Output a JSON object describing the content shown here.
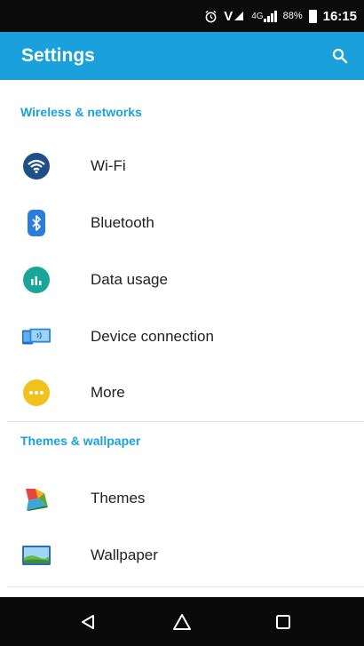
{
  "status_bar": {
    "alarm_icon": "alarm-clock-icon",
    "volte_label": "V",
    "network_type": "4G",
    "battery_percent": "88%",
    "time": "16:15"
  },
  "app_bar": {
    "title": "Settings",
    "search_icon": "search-icon"
  },
  "sections": [
    {
      "header": "Wireless & networks",
      "items": [
        {
          "label": "Wi-Fi",
          "icon": "wifi-icon",
          "color": "#1e4f87"
        },
        {
          "label": "Bluetooth",
          "icon": "bluetooth-icon",
          "color": "#2a7dd9"
        },
        {
          "label": "Data usage",
          "icon": "data-usage-icon",
          "color": "#1aa59a"
        },
        {
          "label": "Device connection",
          "icon": "device-connection-icon",
          "color": "#2f8ad6"
        },
        {
          "label": "More",
          "icon": "more-icon",
          "color": "#f1c21b"
        }
      ]
    },
    {
      "header": "Themes & wallpaper",
      "items": [
        {
          "label": "Themes",
          "icon": "themes-icon",
          "color": "#e8463a"
        },
        {
          "label": "Wallpaper",
          "icon": "wallpaper-icon",
          "color": "#3a8bcf"
        }
      ]
    }
  ],
  "colors": {
    "accent": "#1aa1db",
    "status_bar": "#0b0b0b",
    "nav_bar": "#0a0a0a"
  },
  "nav_bar": {
    "back_icon": "back-triangle-icon",
    "home_icon": "home-icon",
    "recents_icon": "recents-square-icon"
  }
}
